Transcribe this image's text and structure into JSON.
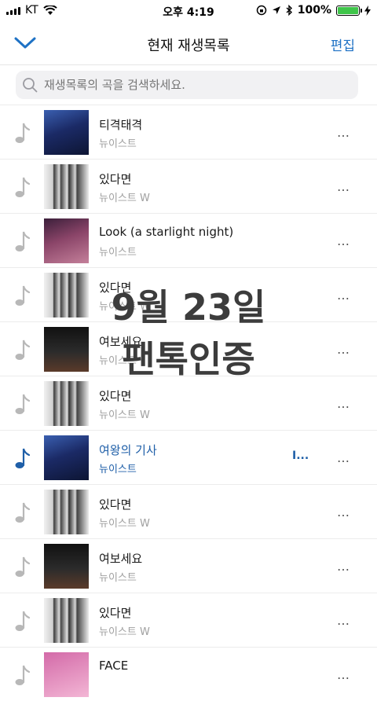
{
  "status_bar": {
    "carrier": "KT",
    "time": "오후 4:19",
    "battery": "100%"
  },
  "header": {
    "title": "현재 재생목록",
    "edit_label": "편집"
  },
  "search": {
    "placeholder": "재생목록의 곡을 검색하세요."
  },
  "tracks": [
    {
      "title": "티격태격",
      "artist": "뉴이스트",
      "playing": false,
      "art": "a"
    },
    {
      "title": "있다면",
      "artist": "뉴이스트 W",
      "playing": false,
      "art": "b"
    },
    {
      "title": "Look (a starlight night)",
      "artist": "뉴이스트",
      "playing": false,
      "art": "c"
    },
    {
      "title": "있다면",
      "artist": "뉴이스트 W",
      "playing": false,
      "art": "b"
    },
    {
      "title": "여보세요",
      "artist": "뉴이스트",
      "playing": false,
      "art": "d"
    },
    {
      "title": "있다면",
      "artist": "뉴이스트 W",
      "playing": false,
      "art": "b"
    },
    {
      "title": "여왕의 기사",
      "artist": "뉴이스트",
      "playing": true,
      "art": "a"
    },
    {
      "title": "있다면",
      "artist": "뉴이스트 W",
      "playing": false,
      "art": "b"
    },
    {
      "title": "여보세요",
      "artist": "뉴이스트",
      "playing": false,
      "art": "d"
    },
    {
      "title": "있다면",
      "artist": "뉴이스트 W",
      "playing": false,
      "art": "b"
    },
    {
      "title": "FACE",
      "artist": "",
      "playing": false,
      "art": "e"
    }
  ],
  "more_label": "…",
  "equalizer_label": "I...",
  "overlay": {
    "line1": "9월 23일",
    "line2": "팬톡인증"
  },
  "colors": {
    "accent": "#1f72c5",
    "playing": "#1f5fa8",
    "battery": "#3fc54a"
  },
  "icons": {
    "back": "chevron-down-icon",
    "search": "search-icon",
    "note": "music-note-icon",
    "more": "more-icon"
  }
}
